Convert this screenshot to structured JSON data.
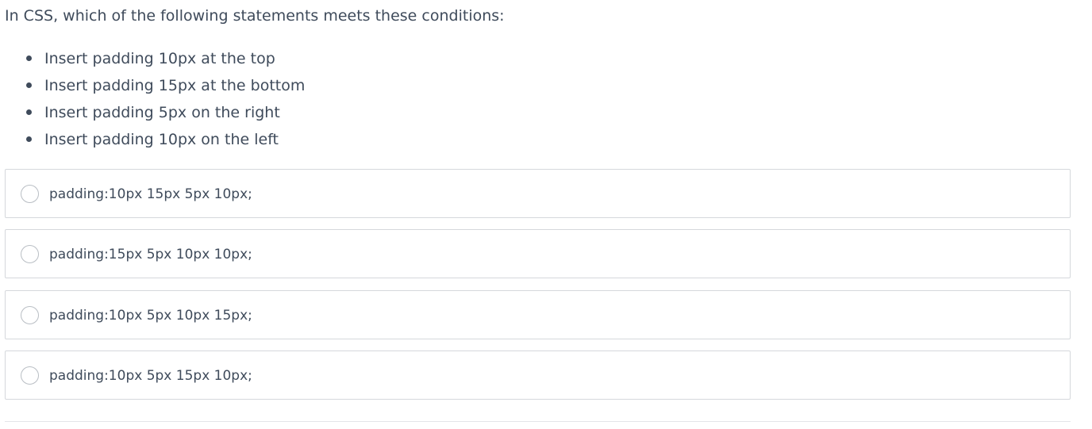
{
  "question": {
    "text": "In CSS, which of the following statements meets these conditions:"
  },
  "conditions": [
    "Insert padding 10px at the top",
    "Insert padding 15px at the bottom",
    "Insert padding 5px on the right",
    "Insert padding 10px on the left"
  ],
  "options": [
    {
      "label": "padding:10px 15px 5px 10px;",
      "selected": false
    },
    {
      "label": "padding:15px 5px 10px 10px;",
      "selected": false
    },
    {
      "label": "padding:10px 5px 10px 15px;",
      "selected": false
    },
    {
      "label": "padding:10px 5px 15px 10px;",
      "selected": false
    }
  ],
  "colors": {
    "text": "#3f4b5b",
    "option_border": "#d5d8dc",
    "radio_border": "#b9bec4"
  }
}
